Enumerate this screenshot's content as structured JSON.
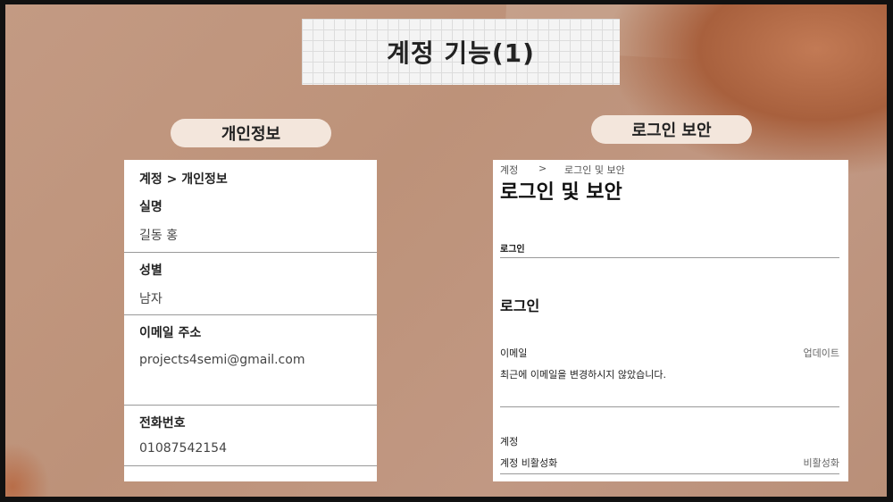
{
  "title": "계정 기능(1)",
  "left_pill": "개인정보",
  "right_pill": "로그인 보안",
  "left_card": {
    "breadcrumb": "계정 > 개인정보",
    "fields": [
      {
        "label": "실명",
        "value": "길동 홍"
      },
      {
        "label": "성별",
        "value": "남자"
      },
      {
        "label": "이메일 주소",
        "value": "projects4semi@gmail.com"
      },
      {
        "label": "전화번호",
        "value": "01087542154"
      }
    ]
  },
  "right_card": {
    "breadcrumb_root": "계정",
    "breadcrumb_sep": ">",
    "breadcrumb_current": "로그인 및 보안",
    "heading": "로그인 및 보안",
    "tab_label": "로그인",
    "section_title": "로그인",
    "email_label": "이메일",
    "email_action": "업데이트",
    "email_desc": "최근에 이메일을 변경하시지 않았습니다.",
    "account_section": "계정",
    "deactivate_label": "계정 비활성화",
    "deactivate_action": "비활성화"
  }
}
